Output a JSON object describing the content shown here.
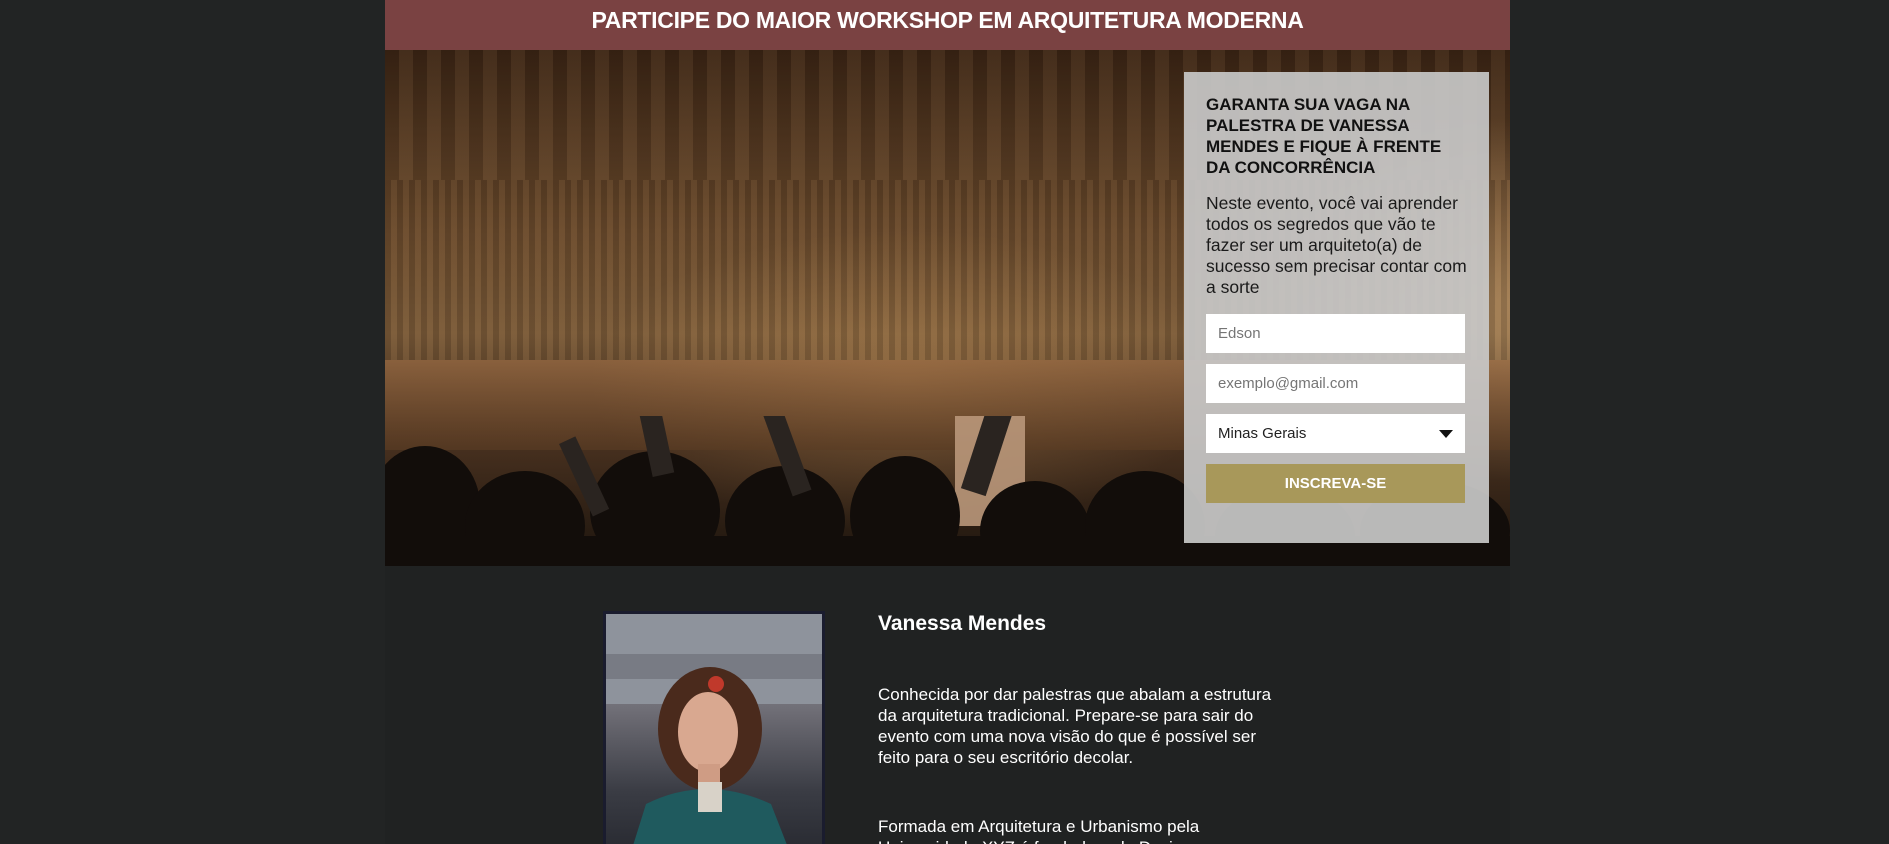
{
  "banner": {
    "title": "PARTICIPE DO MAIOR WORKSHOP EM ARQUITETURA MODERNA"
  },
  "hero": {
    "image": "conference-audience-raising-hands-photo"
  },
  "signup": {
    "heading": "GARANTA SUA VAGA NA PALESTRA DE VANESSA MENDES E FIQUE À FRENTE DA CONCORRÊNCIA",
    "description": "Neste evento, você vai aprender todos os segredos que vão te fazer ser um arquiteto(a) de sucesso sem precisar contar com a sorte",
    "name_placeholder": "Edson",
    "email_placeholder": "exemplo@gmail.com",
    "state_selected": "Minas Gerais",
    "submit_label": "INSCREVA-SE"
  },
  "speaker": {
    "name": "Vanessa Mendes",
    "bio_p1": "Conhecida por dar palestras que abalam a estrutura da arquitetura tradicional. Prepare-se para sair do evento com uma nova visão do que é possível ser feito para o seu escritório decolar.",
    "bio_p2": "Formada em Arquitetura e Urbanismo pela Universidade XYZ é fundadora da Designs",
    "photo": "speaker-portrait-photo"
  },
  "colors": {
    "banner": "#7a4242",
    "page": "#202222",
    "button": "#a8985a",
    "card": "#c8c8c8"
  }
}
